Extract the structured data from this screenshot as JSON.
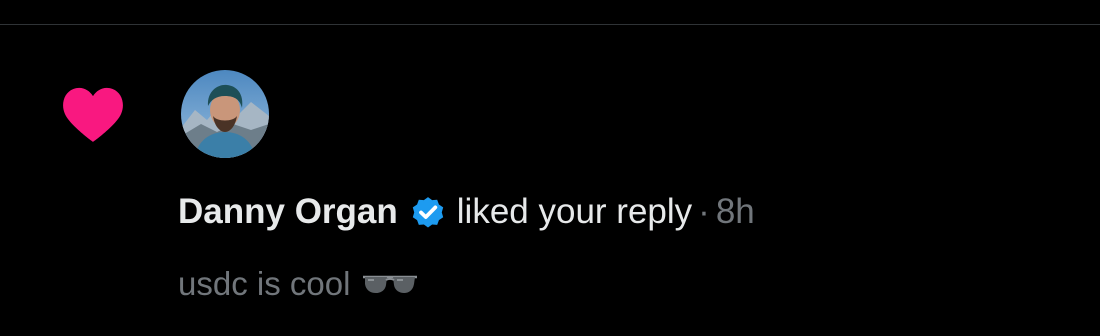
{
  "notification": {
    "user_name": "Danny Organ",
    "action": "liked your reply",
    "separator": "·",
    "time": "8h",
    "reply_text": "usdc is cool",
    "reply_emoji": "sunglasses-icon"
  },
  "icons": {
    "like": "heart-icon",
    "verified": "verified-badge-icon",
    "avatar": "avatar"
  },
  "colors": {
    "background": "#000000",
    "heart": "#f91880",
    "verified": "#1d9bf0",
    "primary_text": "#e7e9ea",
    "secondary_text": "#71767b",
    "divider": "#2f3336"
  }
}
